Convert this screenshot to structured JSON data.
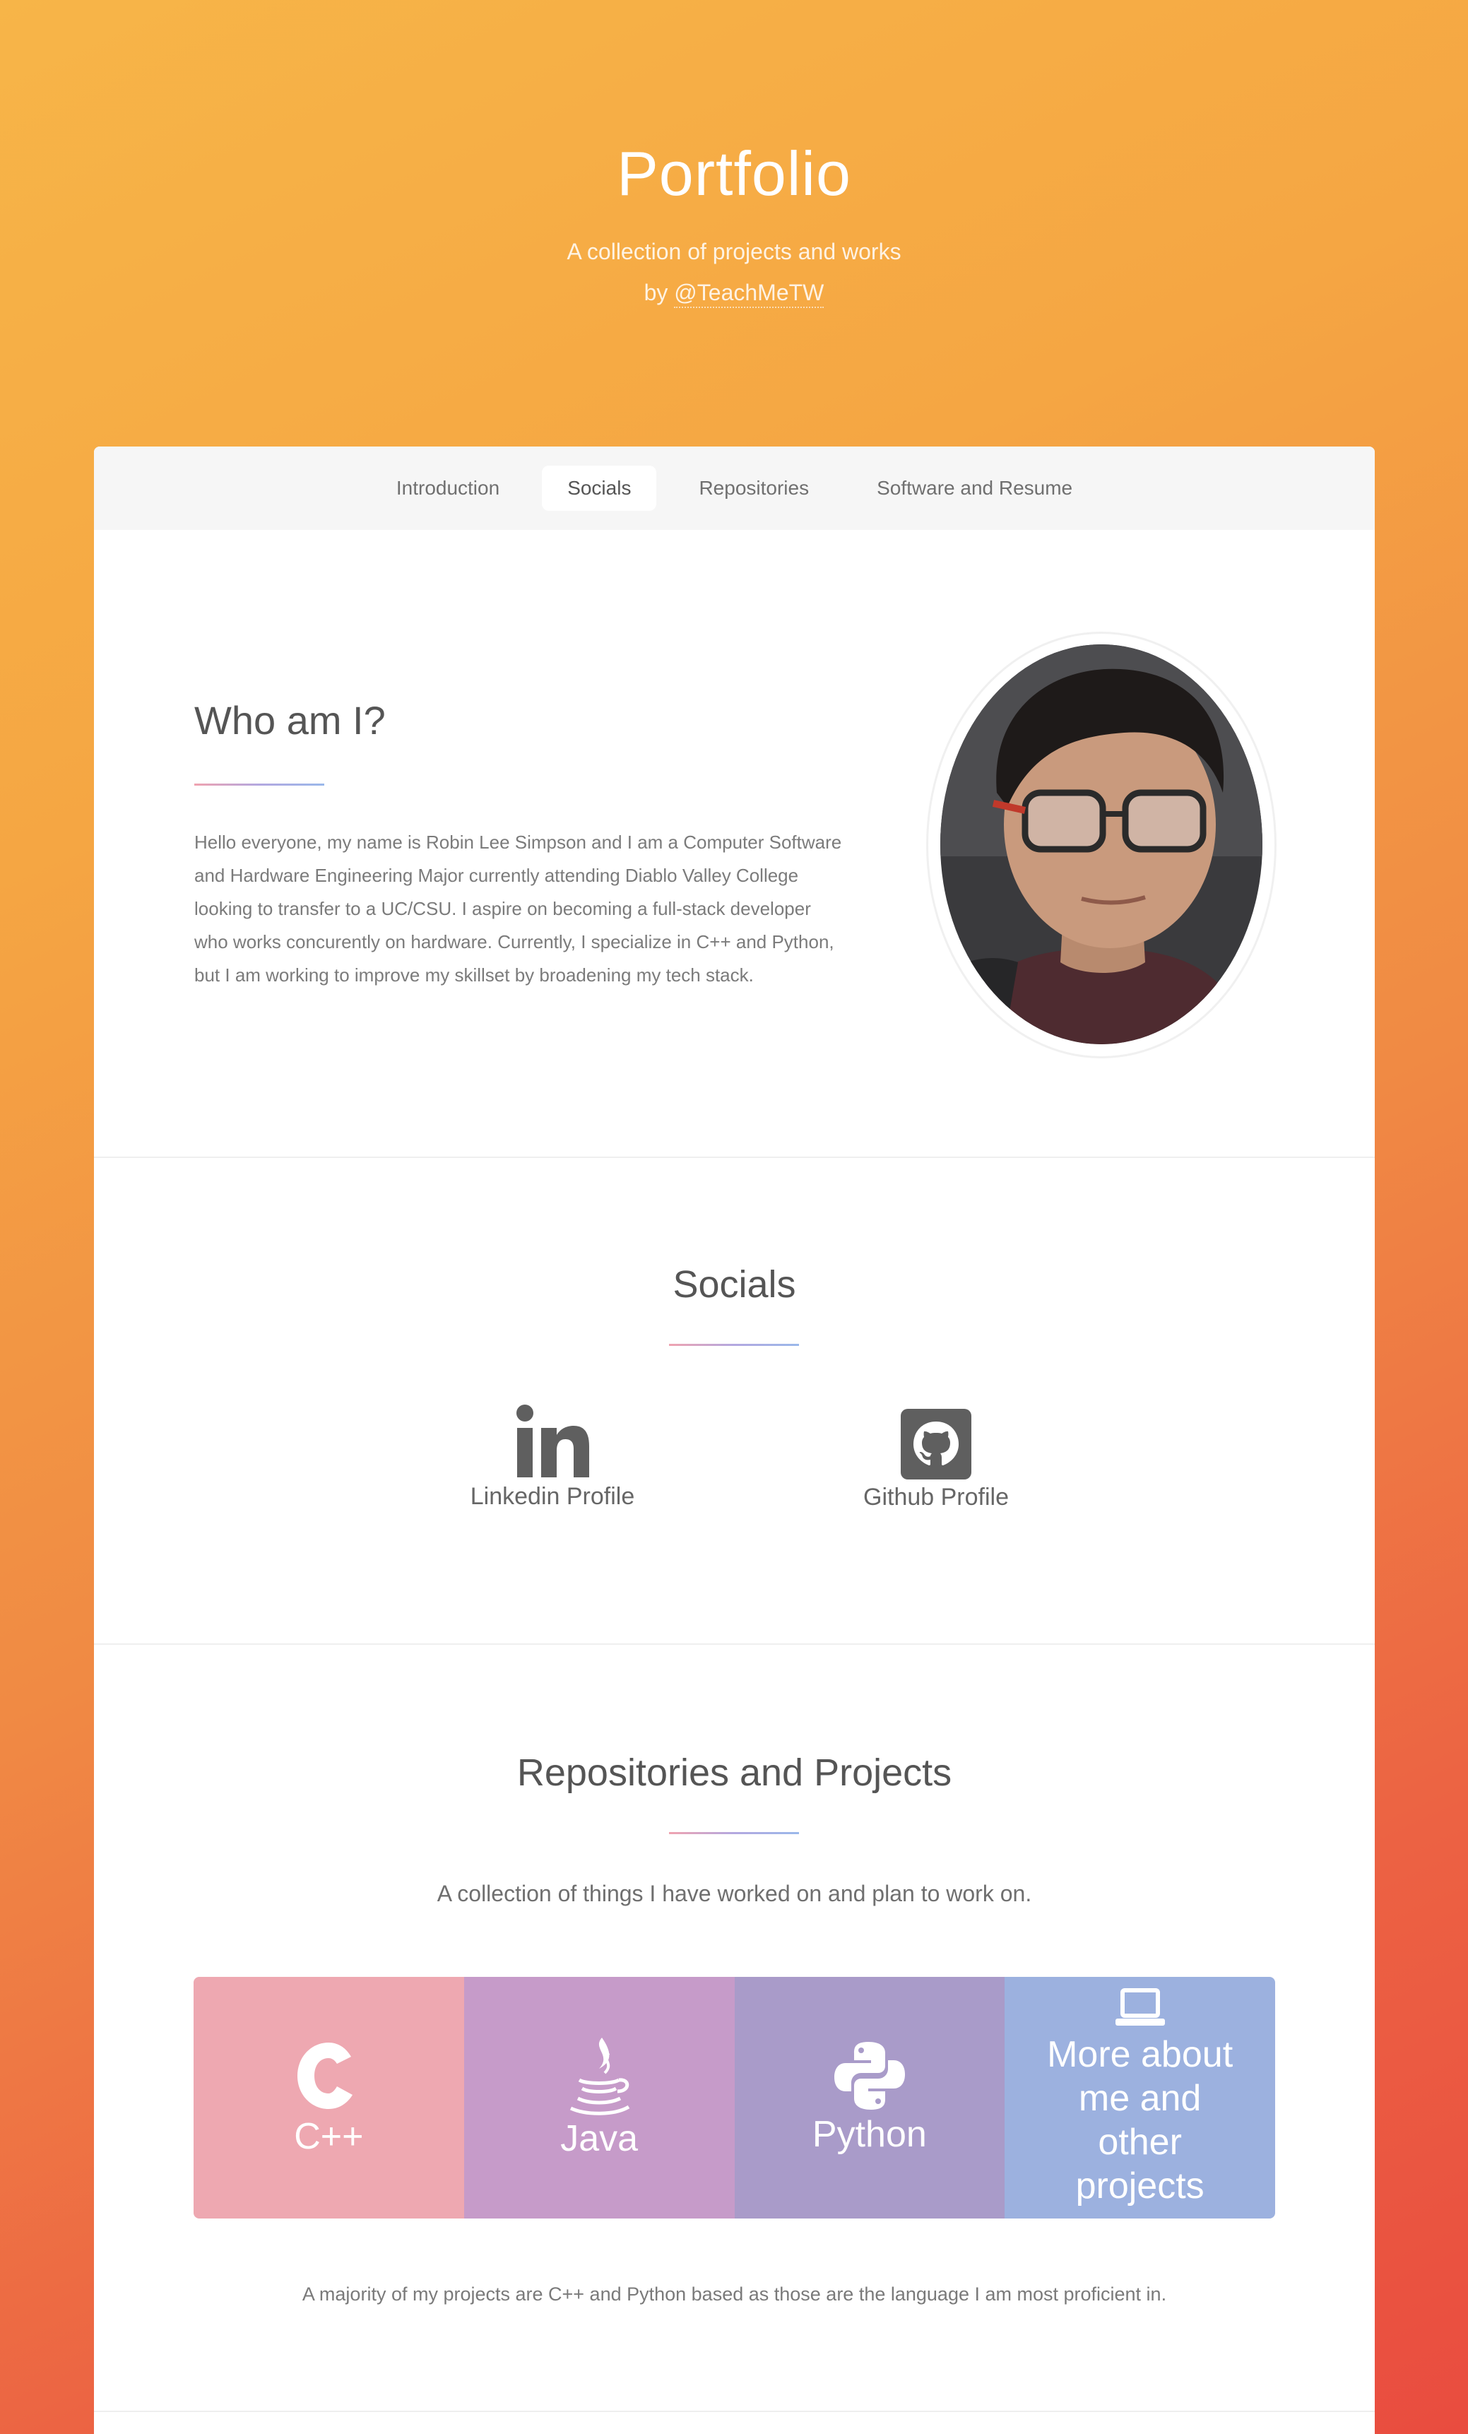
{
  "header": {
    "title": "Portfolio",
    "subtitle": "A collection of projects and works",
    "by_prefix": "by ",
    "handle": "@TeachMeTW"
  },
  "nav": {
    "items": [
      {
        "label": "Introduction",
        "active": false
      },
      {
        "label": "Socials",
        "active": true
      },
      {
        "label": "Repositories",
        "active": false
      },
      {
        "label": "Software and Resume",
        "active": false
      }
    ]
  },
  "intro": {
    "heading": "Who am I?",
    "bio": "Hello everyone, my name is Robin Lee Simpson and I am a Computer Software and Hardware Engineering Major currently attending Diablo Valley College looking to transfer to a UC/CSU. I aspire on becoming a full-stack developer who works concurently on hardware. Currently, I specialize in C++ and Python, but I am working to improve my skillset by broadening my tech stack."
  },
  "socials": {
    "heading": "Socials",
    "items": [
      {
        "label": "Linkedin Profile",
        "icon": "linkedin-icon"
      },
      {
        "label": "Github Profile",
        "icon": "github-icon"
      }
    ]
  },
  "repos": {
    "heading": "Repositories and Projects",
    "description": "A collection of things I have worked on and plan to work on.",
    "tiles": [
      {
        "label": "C++",
        "icon": "cpp-icon",
        "color": "#eea8b1"
      },
      {
        "label": "Java",
        "icon": "java-icon",
        "color": "#c69bc9"
      },
      {
        "label": "Python",
        "icon": "python-icon",
        "color": "#a99bc9"
      },
      {
        "label": "More about me and other projects",
        "icon": "laptop-icon",
        "color": "#9cb1df"
      }
    ],
    "footnote": "A majority of my projects are C++ and Python based as those are the language I am most proficient in."
  },
  "colors": {
    "gradient_top": "#f7b548",
    "gradient_bottom": "#e94c3f",
    "accent_line_start": "#f0a3b0",
    "accent_line_end": "#9ab8ea"
  }
}
